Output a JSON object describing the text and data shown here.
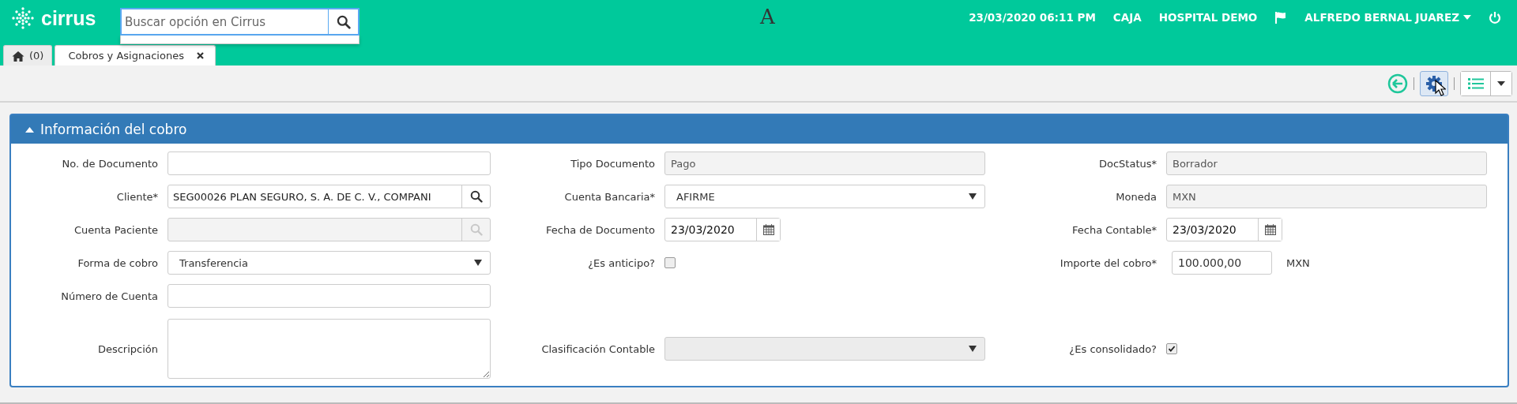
{
  "header": {
    "logo_text": "cirrus",
    "search": {
      "placeholder": "Buscar opción en Cirrus"
    },
    "stray_text": "A",
    "datetime": "23/03/2020 06:11 PM",
    "cash_register": "CAJA",
    "hospital": "HOSPITAL DEMO",
    "user": "ALFREDO BERNAL JUAREZ"
  },
  "tabs": [
    {
      "kind": "home",
      "label": "(0)",
      "selected": false
    },
    {
      "kind": "document",
      "label": "Cobros y Asignaciones",
      "selected": true,
      "closable": true
    }
  ],
  "toolbar": {
    "settings_pressed": true
  },
  "panel": {
    "title": "Información del cobro",
    "expanded": true,
    "rows": [
      {
        "cells": [
          {
            "kind": "text",
            "label": "No. de Documento",
            "disabled": false
          },
          {
            "kind": "text",
            "label": "Tipo Documento",
            "value": "Pago",
            "disabled": true
          },
          {
            "kind": "text",
            "label": "DocStatus*",
            "value": "Borrador",
            "disabled": true
          }
        ]
      },
      {
        "cells": [
          {
            "kind": "lookup",
            "label": "Cliente*",
            "value": "SEG00026 PLAN SEGURO, S. A. DE C. V., COMPANI",
            "disabled": false
          },
          {
            "kind": "select",
            "label": "Cuenta Bancaria*",
            "value": "AFIRME",
            "disabled": false
          },
          {
            "kind": "text",
            "label": "Moneda",
            "value": "MXN",
            "disabled": true
          }
        ]
      },
      {
        "cells": [
          {
            "kind": "lookup",
            "label": "Cuenta Paciente",
            "disabled": true
          },
          {
            "kind": "date",
            "label": "Fecha de Documento",
            "value": "23/03/2020"
          },
          {
            "kind": "date",
            "label": "Fecha Contable*",
            "value": "23/03/2020"
          }
        ]
      },
      {
        "cells": [
          {
            "kind": "select",
            "label": "Forma de cobro",
            "value": "Transferencia",
            "disabled": false
          },
          {
            "kind": "checkbox",
            "label": "¿Es anticipo?",
            "checked": false
          },
          {
            "kind": "amount",
            "label": "Importe del cobro*",
            "value": "100.000,00",
            "unit": "MXN"
          }
        ]
      },
      {
        "cells": [
          {
            "kind": "text",
            "label": "Número de Cuenta",
            "disabled": false
          },
          {
            "kind": "empty"
          },
          {
            "kind": "empty"
          }
        ]
      },
      {
        "cells": [
          {
            "kind": "textarea",
            "label": "Descripción"
          },
          {
            "kind": "select",
            "label": "Clasificación Contable",
            "disabled": true
          },
          {
            "kind": "checkbox",
            "label": "¿Es consolidado?",
            "checked": true
          }
        ]
      }
    ]
  }
}
